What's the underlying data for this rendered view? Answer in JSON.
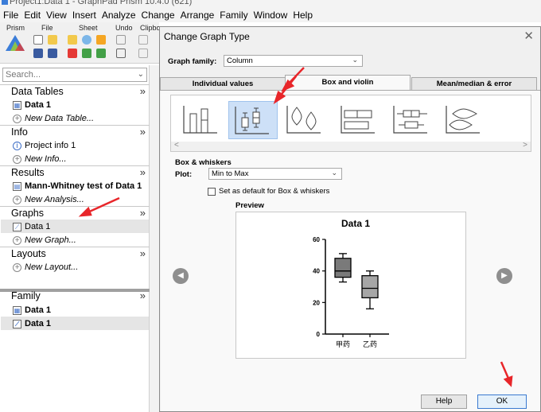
{
  "app": {
    "title": "Project1:Data 1 - GraphPad Prism 10.4.0 (621)",
    "menu": [
      "File",
      "Edit",
      "View",
      "Insert",
      "Analyze",
      "Change",
      "Arrange",
      "Family",
      "Window",
      "Help"
    ]
  },
  "ribbon": {
    "groups": [
      "Prism",
      "File",
      "Sheet",
      "Undo",
      "Clipbo"
    ]
  },
  "sidebar": {
    "search_placeholder": "Search...",
    "sections": {
      "data_tables": {
        "title": "Data Tables",
        "items": [
          "Data 1",
          "New Data Table..."
        ]
      },
      "info": {
        "title": "Info",
        "items": [
          "Project info 1",
          "New Info..."
        ]
      },
      "results": {
        "title": "Results",
        "items": [
          "Mann-Whitney test of Data 1",
          "New Analysis..."
        ]
      },
      "graphs": {
        "title": "Graphs",
        "items": [
          "Data 1",
          "New Graph..."
        ]
      },
      "layouts": {
        "title": "Layouts",
        "items": [
          "New Layout..."
        ]
      },
      "family": {
        "title": "Family",
        "items": [
          "Data 1",
          "Data 1"
        ]
      }
    },
    "expand_glyph": "»"
  },
  "dialog": {
    "title": "Change Graph Type",
    "close_glyph": "✕",
    "graph_family_label": "Graph family:",
    "graph_family_value": "Column",
    "tabs": [
      "Individual values",
      "Box and violin",
      "Mean/median & error"
    ],
    "active_tab": "Box and violin",
    "gallery": {
      "items": [
        "box-plot-simple",
        "box-and-whiskers",
        "violin-plot",
        "horizontal-box",
        "horizontal-box-and-whiskers",
        "horizontal-violin"
      ],
      "selected_index": 1,
      "scroll_left": "<",
      "scroll_right": ">"
    },
    "section_title": "Box & whiskers",
    "plot_label": "Plot:",
    "plot_value": "Min to Max",
    "default_checkbox_label": "Set as default for Box & whiskers",
    "default_checked": false,
    "preview_label": "Preview",
    "prev_glyph": "◀",
    "next_glyph": "▶",
    "help_label": "Help",
    "ok_label": "OK"
  },
  "chart_data": {
    "type": "box",
    "title": "Data 1",
    "xlabel": "",
    "ylabel": "",
    "ylim": [
      0,
      60
    ],
    "yticks": [
      "0",
      "20",
      "40",
      "60"
    ],
    "categories": [
      "甲药",
      "乙药"
    ],
    "boxes": [
      {
        "name": "甲药",
        "min": 33,
        "q1": 36,
        "median": 40,
        "q3": 48,
        "max": 51
      },
      {
        "name": "乙药",
        "min": 16,
        "q1": 23,
        "median": 29,
        "q3": 37,
        "max": 40
      }
    ],
    "box_fill": [
      "#7a7a7a",
      "#a6a6a6"
    ]
  },
  "colors": {
    "selection": "#cde0f7",
    "annotation_arrow": "#e8262a",
    "ok_border": "#3a79d0"
  }
}
